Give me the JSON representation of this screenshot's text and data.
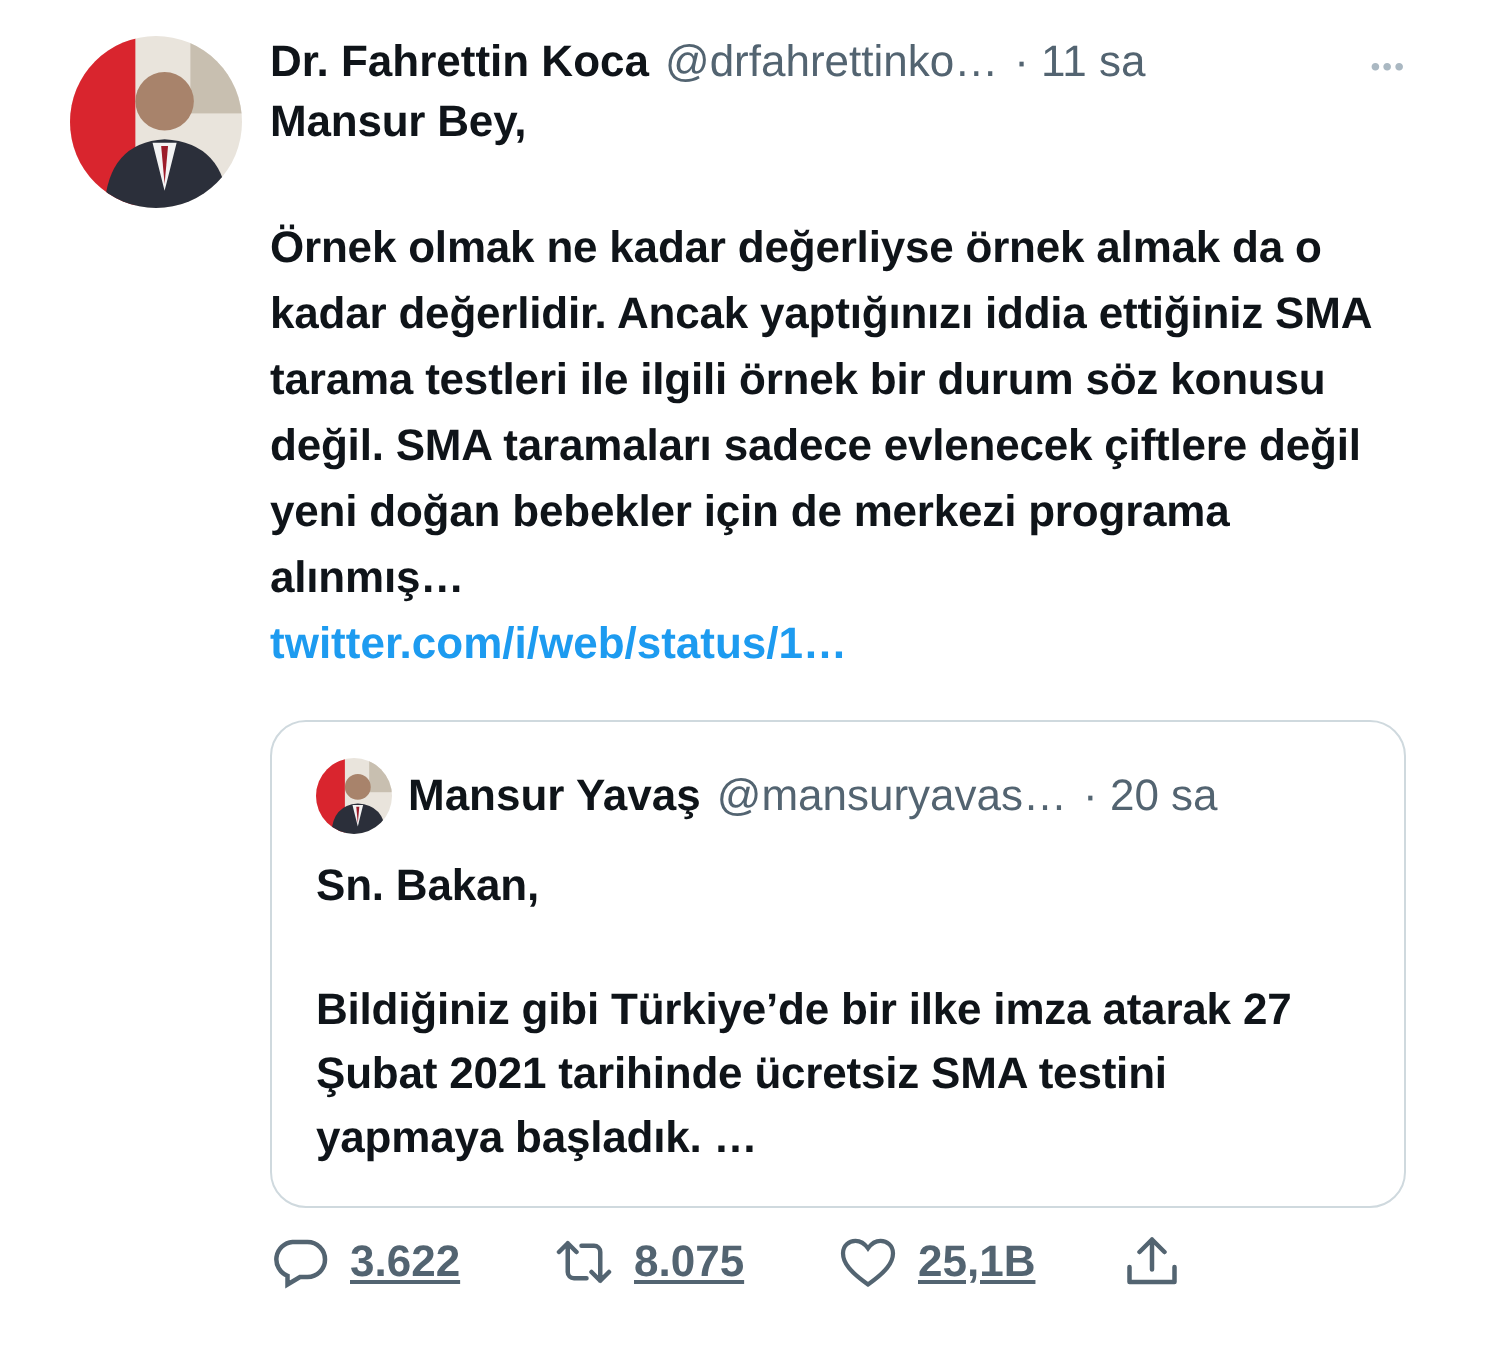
{
  "tweet": {
    "author_name": "Dr. Fahrettin Koca",
    "handle": "@drfahrettinko…",
    "time": "· 11 sa",
    "more": "•••",
    "paragraphs": [
      "Mansur Bey,",
      "Örnek olmak ne kadar değerliyse örnek almak da o kadar değerlidir. Ancak yaptığınızı iddia ettiğiniz SMA tarama testleri ile ilgili örnek bir durum söz konusu değil. SMA taramaları sadece evlenecek çiftlere değil yeni doğan bebekler için de merkezi programa alınmış…"
    ],
    "link": "twitter.com/i/web/status/1…",
    "quoted": {
      "author_name": "Mansur Yavaş",
      "handle": "@mansuryavas…",
      "time": "· 20 sa",
      "paragraphs": [
        "Sn. Bakan,",
        "Bildiğiniz gibi Türkiye’de bir ilke imza atarak 27 Şubat 2021 tarihinde ücretsiz SMA testini yapmaya başladık. …"
      ]
    },
    "actions": [
      {
        "kind": "reply",
        "count": "3.622"
      },
      {
        "kind": "retweet",
        "count": "8.075"
      },
      {
        "kind": "like",
        "count": "25,1B"
      },
      {
        "kind": "share"
      }
    ]
  }
}
